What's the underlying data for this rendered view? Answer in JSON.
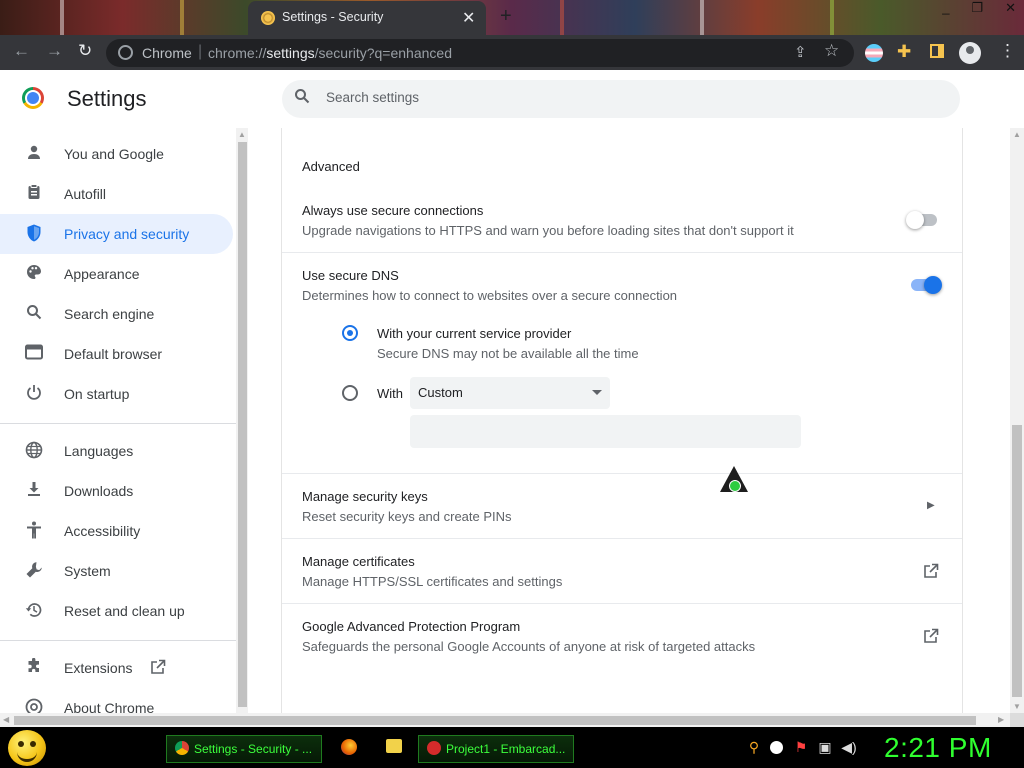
{
  "window": {
    "active_tab_title": "Settings - Security",
    "new_tab_symbol": "+",
    "controls": [
      "_",
      "❐",
      "✕"
    ]
  },
  "toolbar": {
    "site_chip": "Chrome",
    "url_scheme": "chrome://",
    "url_host": "settings",
    "url_path": "/security?q=enhanced"
  },
  "header": {
    "title": "Settings",
    "search_placeholder": "Search settings"
  },
  "sidebar": {
    "items": [
      {
        "label": "You and Google",
        "icon": "person-icon"
      },
      {
        "label": "Autofill",
        "icon": "clipboard-icon"
      },
      {
        "label": "Privacy and security",
        "icon": "shield-icon",
        "active": true
      },
      {
        "label": "Appearance",
        "icon": "palette-icon"
      },
      {
        "label": "Search engine",
        "icon": "search-icon"
      },
      {
        "label": "Default browser",
        "icon": "browser-icon"
      },
      {
        "label": "On startup",
        "icon": "power-icon"
      },
      {
        "label": "Languages",
        "icon": "globe-icon"
      },
      {
        "label": "Downloads",
        "icon": "download-icon"
      },
      {
        "label": "Accessibility",
        "icon": "accessibility-icon"
      },
      {
        "label": "System",
        "icon": "wrench-icon"
      },
      {
        "label": "Reset and clean up",
        "icon": "restore-icon"
      },
      {
        "label": "Extensions",
        "icon": "puzzle-icon"
      },
      {
        "label": "About Chrome",
        "icon": "chrome-icon"
      }
    ]
  },
  "main": {
    "section_title": "Advanced",
    "https_only": {
      "title": "Always use secure connections",
      "subtitle": "Upgrade navigations to HTTPS and warn you before loading sites that don't support it",
      "enabled": false
    },
    "secure_dns": {
      "title": "Use secure DNS",
      "subtitle": "Determines how to connect to websites over a secure connection",
      "enabled": true,
      "option_current": {
        "title": "With your current service provider",
        "subtitle": "Secure DNS may not be available all the time",
        "selected": true
      },
      "option_custom": {
        "label": "With",
        "select_value": "Custom",
        "selected": false,
        "custom_value": ""
      }
    },
    "security_keys": {
      "title": "Manage security keys",
      "subtitle": "Reset security keys and create PINs"
    },
    "certificates": {
      "title": "Manage certificates",
      "subtitle": "Manage HTTPS/SSL certificates and settings"
    },
    "advanced_protection": {
      "title": "Google Advanced Protection Program",
      "subtitle": "Safeguards the personal Google Accounts of anyone at risk of targeted attacks"
    }
  },
  "taskbar": {
    "tasks": [
      {
        "label": "Settings - Security - ...",
        "icon": "chrome-icon"
      },
      {
        "label": "Project1 - Embarcad...",
        "icon": "embarcadero-icon"
      }
    ],
    "clock": "2:21 PM",
    "colors": {
      "accent": "#2fff2f",
      "taskbar": "#000000"
    }
  },
  "colors": {
    "chrome_blue": "#1a73e8",
    "active_nav_bg": "#e8f0fe",
    "toolbar_bg": "#35363a"
  }
}
